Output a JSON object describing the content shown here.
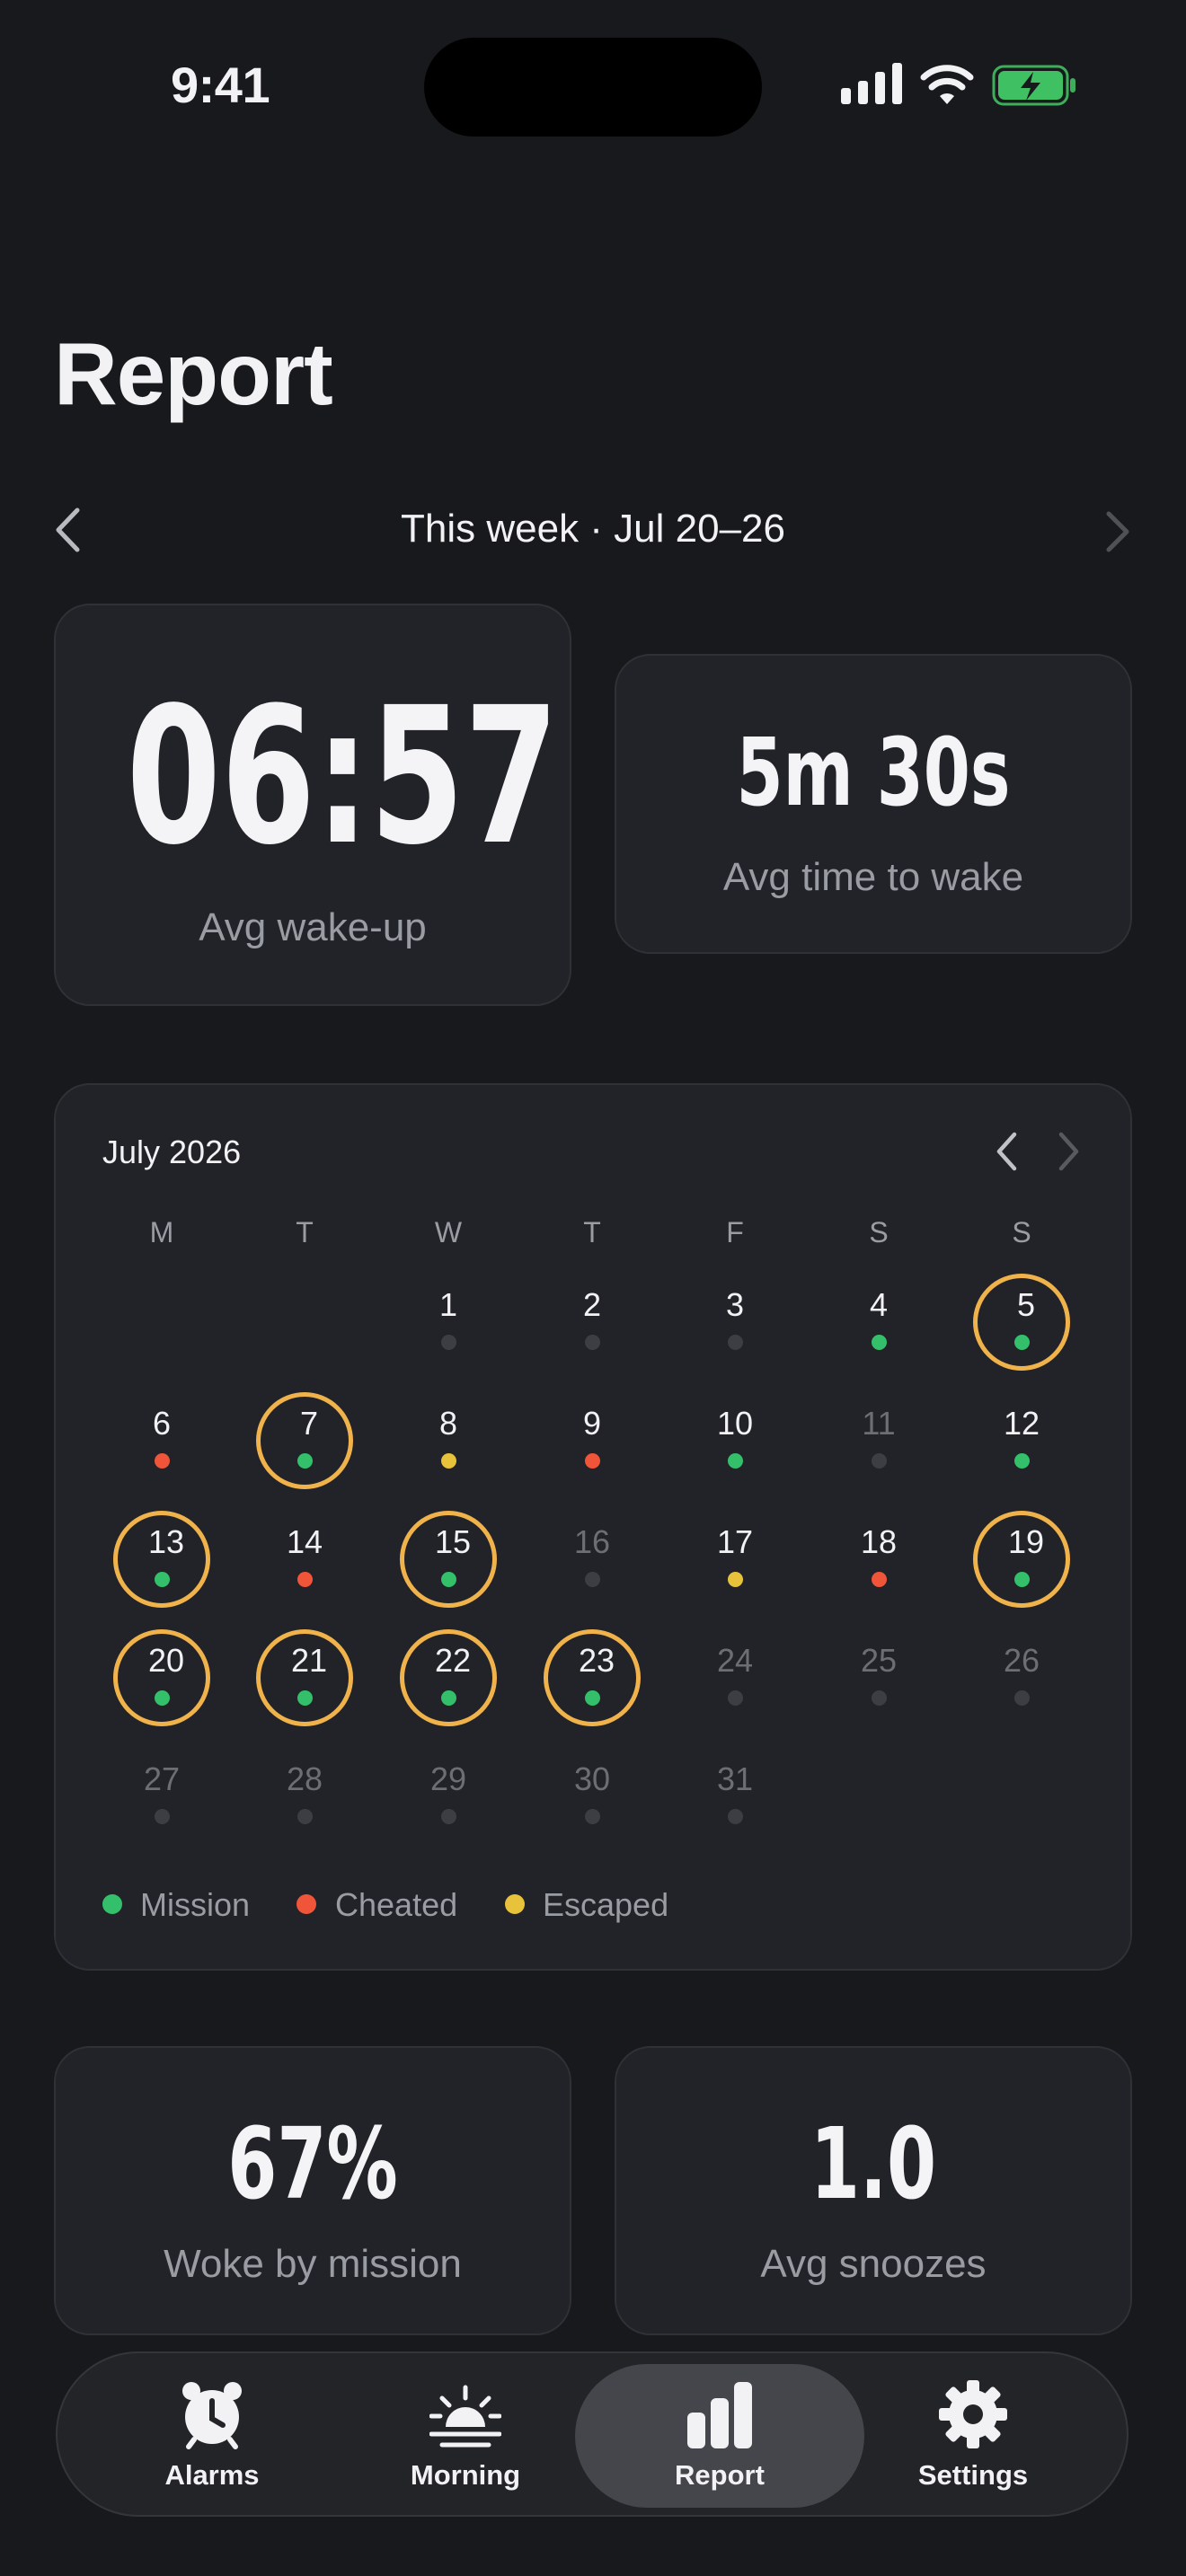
{
  "status_bar": {
    "time": "9:41"
  },
  "title": "Report",
  "week_nav": {
    "label": "This week · Jul 20–26"
  },
  "stats": {
    "avg_wakeup": {
      "value": "06:57",
      "label": "Avg wake-up"
    },
    "avg_time_to_wake": {
      "value": "5m 30s",
      "label": "Avg time to wake"
    },
    "woke_by_mission": {
      "value": "67%",
      "label": "Woke by mission"
    },
    "avg_snoozes": {
      "value": "1.0",
      "label": "Avg snoozes"
    }
  },
  "calendar": {
    "month_label": "July 2026",
    "weekdays": [
      "M",
      "T",
      "W",
      "T",
      "F",
      "S",
      "S"
    ],
    "first_weekday_index": 2,
    "days": [
      {
        "d": "1",
        "status": "none",
        "dim": false,
        "ring": false
      },
      {
        "d": "2",
        "status": "none",
        "dim": false,
        "ring": false
      },
      {
        "d": "3",
        "status": "none",
        "dim": false,
        "ring": false
      },
      {
        "d": "4",
        "status": "mission",
        "dim": false,
        "ring": false
      },
      {
        "d": "5",
        "status": "mission",
        "dim": false,
        "ring": true
      },
      {
        "d": "6",
        "status": "cheated",
        "dim": false,
        "ring": false
      },
      {
        "d": "7",
        "status": "mission",
        "dim": false,
        "ring": true
      },
      {
        "d": "8",
        "status": "escaped",
        "dim": false,
        "ring": false
      },
      {
        "d": "9",
        "status": "cheated",
        "dim": false,
        "ring": false
      },
      {
        "d": "10",
        "status": "mission",
        "dim": false,
        "ring": false
      },
      {
        "d": "11",
        "status": "none",
        "dim": true,
        "ring": false
      },
      {
        "d": "12",
        "status": "mission",
        "dim": false,
        "ring": false
      },
      {
        "d": "13",
        "status": "mission",
        "dim": false,
        "ring": true
      },
      {
        "d": "14",
        "status": "cheated",
        "dim": false,
        "ring": false
      },
      {
        "d": "15",
        "status": "mission",
        "dim": false,
        "ring": true
      },
      {
        "d": "16",
        "status": "none",
        "dim": true,
        "ring": false
      },
      {
        "d": "17",
        "status": "escaped",
        "dim": false,
        "ring": false
      },
      {
        "d": "18",
        "status": "cheated",
        "dim": false,
        "ring": false
      },
      {
        "d": "19",
        "status": "mission",
        "dim": false,
        "ring": true
      },
      {
        "d": "20",
        "status": "mission",
        "dim": false,
        "ring": true
      },
      {
        "d": "21",
        "status": "mission",
        "dim": false,
        "ring": true
      },
      {
        "d": "22",
        "status": "mission",
        "dim": false,
        "ring": true
      },
      {
        "d": "23",
        "status": "mission",
        "dim": false,
        "ring": true
      },
      {
        "d": "24",
        "status": "none",
        "dim": true,
        "ring": false
      },
      {
        "d": "25",
        "status": "none",
        "dim": true,
        "ring": false
      },
      {
        "d": "26",
        "status": "none",
        "dim": true,
        "ring": false
      },
      {
        "d": "27",
        "status": "none",
        "dim": true,
        "ring": false
      },
      {
        "d": "28",
        "status": "none",
        "dim": true,
        "ring": false
      },
      {
        "d": "29",
        "status": "none",
        "dim": true,
        "ring": false
      },
      {
        "d": "30",
        "status": "none",
        "dim": true,
        "ring": false
      },
      {
        "d": "31",
        "status": "none",
        "dim": true,
        "ring": false
      }
    ],
    "legend": [
      {
        "label": "Mission",
        "color": "#34c06a"
      },
      {
        "label": "Cheated",
        "color": "#f0553a"
      },
      {
        "label": "Escaped",
        "color": "#e8c23a"
      }
    ],
    "status_colors": {
      "mission": "#34c06a",
      "cheated": "#f0553a",
      "escaped": "#e8c23a",
      "none": "#3c3e44"
    },
    "ring_color": "#f0b24a"
  },
  "tabs": [
    {
      "label": "Alarms",
      "icon": "alarm-clock-icon",
      "active": false
    },
    {
      "label": "Morning",
      "icon": "sunrise-icon",
      "active": false
    },
    {
      "label": "Report",
      "icon": "bar-chart-icon",
      "active": true
    },
    {
      "label": "Settings",
      "icon": "gear-icon",
      "active": false
    }
  ]
}
